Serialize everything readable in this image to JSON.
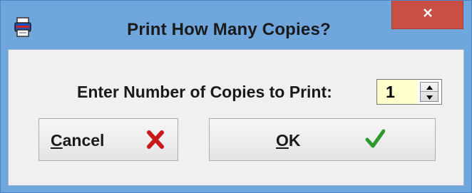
{
  "window": {
    "title": "Print How Many Copies?",
    "app_icon": "printer-app-icon",
    "close_icon": "close-icon"
  },
  "prompt": {
    "label": "Enter Number of Copies to Print:",
    "copies_value": "1"
  },
  "buttons": {
    "cancel": {
      "mnemonic": "C",
      "rest": "ancel",
      "icon": "x-icon"
    },
    "ok": {
      "mnemonic": "O",
      "rest": "K",
      "icon": "checkmark-icon"
    }
  },
  "colors": {
    "frame": "#6fa6dc",
    "close_button": "#c84f44",
    "input_background": "#ffffcc",
    "cancel_icon": "#c8191b",
    "ok_icon": "#2e9a2e"
  }
}
